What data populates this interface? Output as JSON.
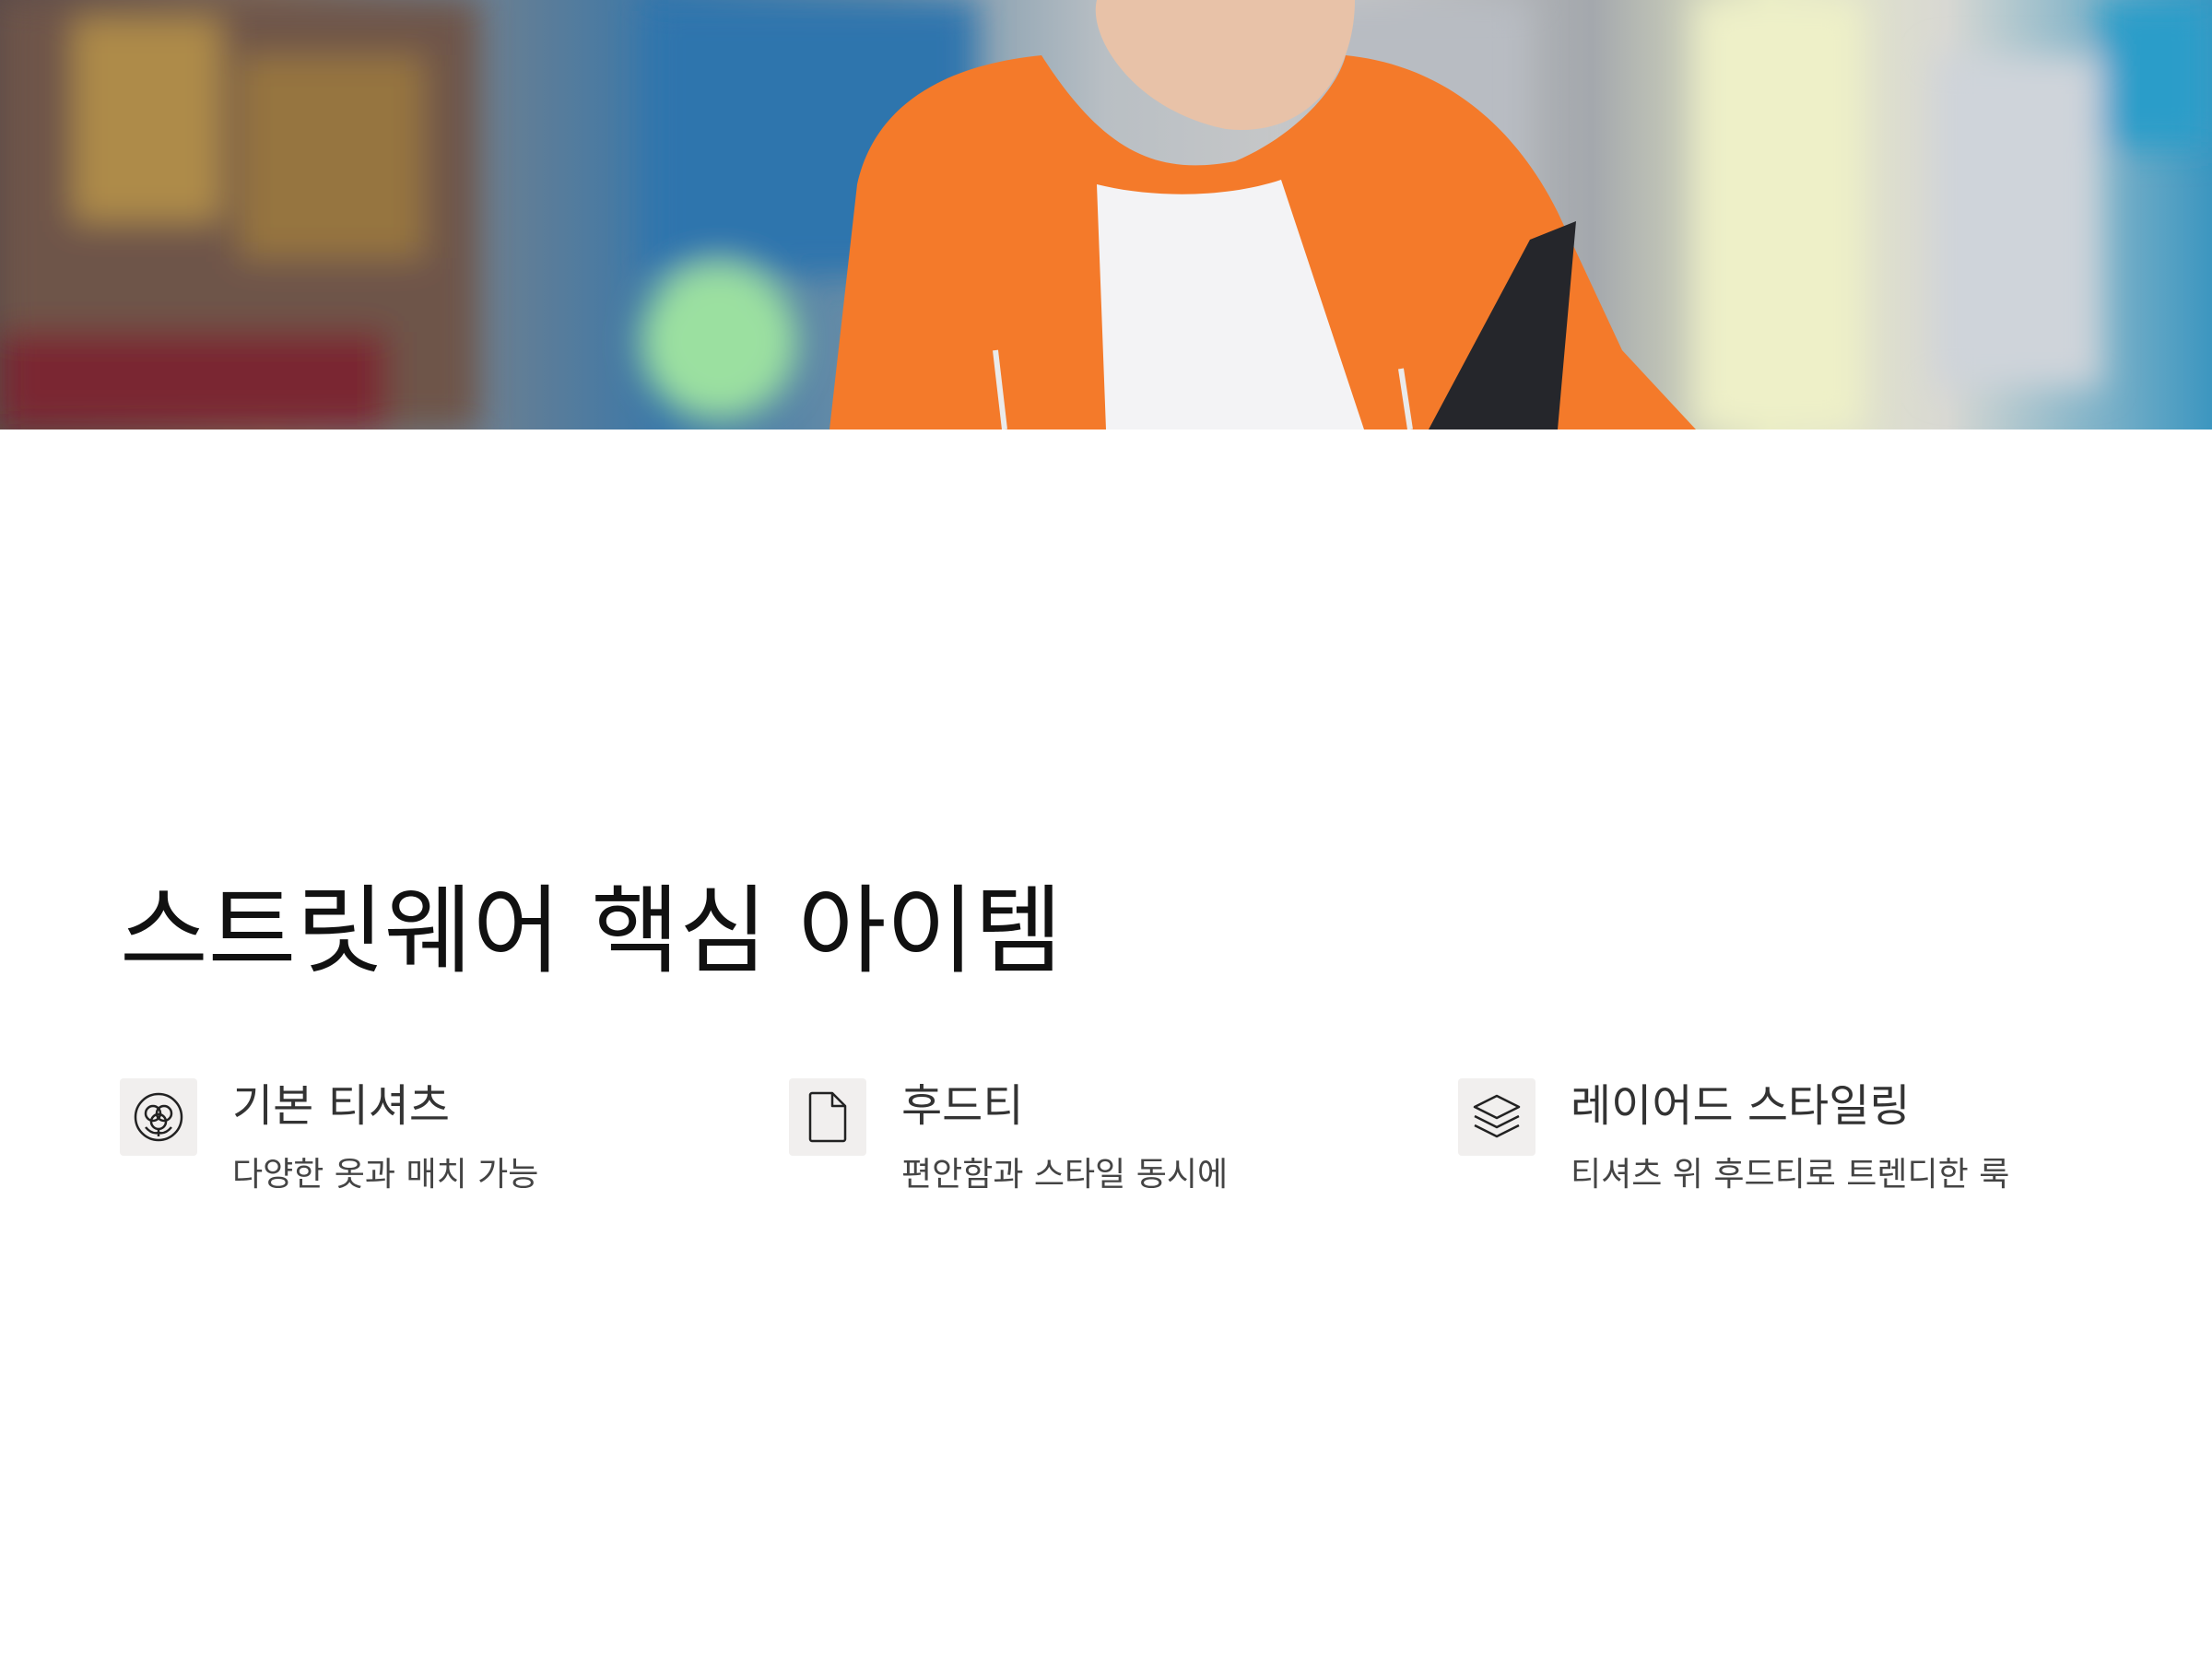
{
  "hero": {
    "image_alt": "orange-hoodie-street-photo"
  },
  "heading": "스트릿웨어 핵심 아이템",
  "features": [
    {
      "icon": "cotton-flower-icon",
      "title": "기본 티셔츠",
      "description": "다양한 옷과 매치 가능"
    },
    {
      "icon": "file-icon",
      "title": "후드티",
      "description": "편안함과 스타일 동시에"
    },
    {
      "icon": "layers-icon",
      "title": "레이어드 스타일링",
      "description": "티셔츠 위 후드티로 트렌디한 룩"
    }
  ],
  "colors": {
    "accent_orange": "#f47a2a",
    "icon_bg": "#f1efee"
  }
}
